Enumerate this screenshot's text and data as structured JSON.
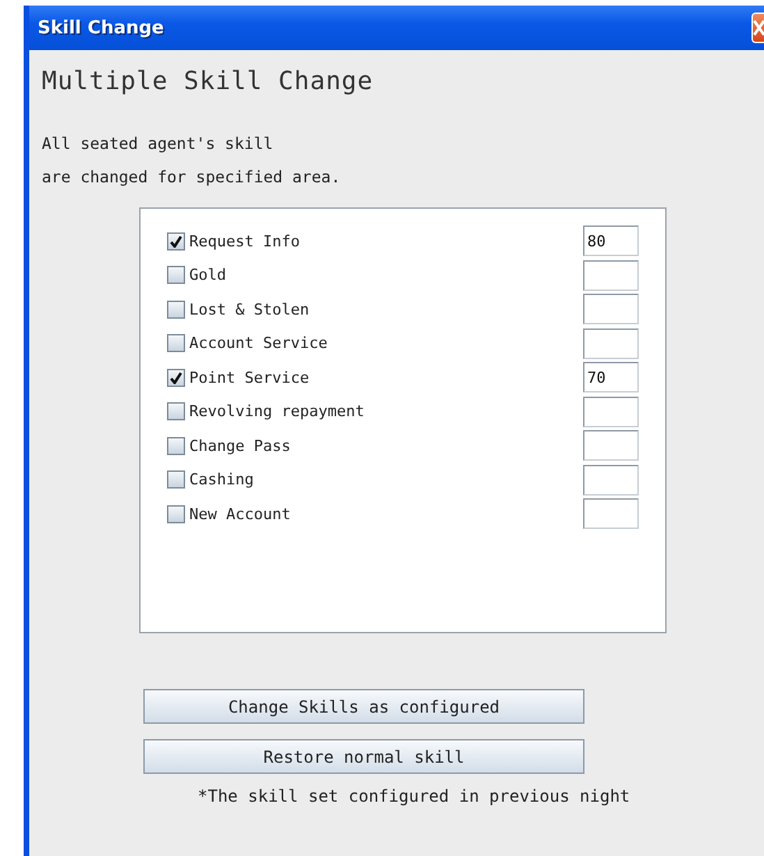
{
  "window": {
    "title": "Skill Change"
  },
  "heading": "Multiple Skill Change",
  "description": [
    "All seated agent's skill",
    "are changed for specified area."
  ],
  "skills": [
    {
      "label": "Request Info",
      "checked": true,
      "value": "80"
    },
    {
      "label": "Gold",
      "checked": false
    },
    {
      "label": "Lost & Stolen",
      "checked": false
    },
    {
      "label": "Account Service",
      "checked": false
    },
    {
      "label": "Point Service",
      "checked": true,
      "value": "70"
    },
    {
      "label": "Revolving repayment",
      "checked": false
    },
    {
      "label": "Change Pass",
      "checked": false
    },
    {
      "label": "Cashing",
      "checked": false
    },
    {
      "label": "New Account",
      "checked": false
    }
  ],
  "buttons": [
    "Change Skills as configured",
    "Restore normal skill"
  ],
  "footnote": "*The skill set configured in previous night"
}
